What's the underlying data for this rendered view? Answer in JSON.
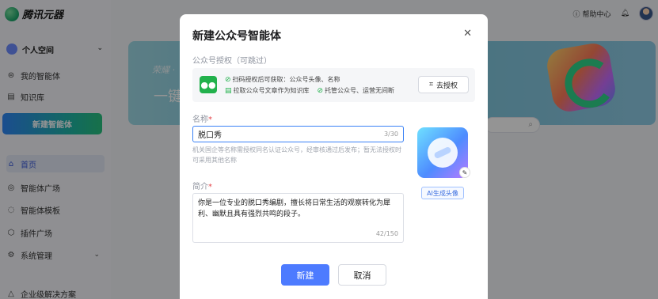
{
  "app": {
    "logo_text": "腾讯元器",
    "help_label": "帮助中心",
    "sidebar": {
      "space_label": "个人空间",
      "items_top": [
        {
          "label": "我的智能体",
          "icon": "agent-icon"
        },
        {
          "label": "知识库",
          "icon": "book-icon"
        }
      ],
      "new_agent_label": "新建智能体",
      "items_main": [
        {
          "label": "首页",
          "icon": "home-icon",
          "active": true
        },
        {
          "label": "智能体广场",
          "icon": "eye-icon"
        },
        {
          "label": "智能体模板",
          "icon": "template-icon"
        },
        {
          "label": "插件广场",
          "icon": "plugin-icon"
        },
        {
          "label": "系统管理",
          "icon": "gear-icon"
        }
      ],
      "enterprise_label": "企业级解决方案"
    },
    "banner": {
      "line1": "荣耀 ·",
      "line2": "一键"
    }
  },
  "modal": {
    "title": "新建公众号智能体",
    "auth_section_label": "公众号授权（可跳过）",
    "auth_features": [
      "扫码授权后可获取：公众号头像、名称",
      "拉取公众号文章作为知识库",
      "托管公众号、运营无间断"
    ],
    "auth_button_label": "去授权",
    "name_label": "名称",
    "name_value": "脱口秀",
    "name_count": "3/30",
    "name_hint": "机关国企等名称需授权同名认证公众号，经审核通过后发布；暂无法授权时可采用其他名称",
    "ai_avatar_label": "AI生成头像",
    "intro_label": "简介",
    "intro_value": "你是一位专业的脱口秀编剧，擅长将日常生活的观察转化为犀利、幽默且具有强烈共鸣的段子。",
    "intro_count": "42/150",
    "create_label": "新建",
    "cancel_label": "取消"
  },
  "colors": {
    "primary": "#4d7bff",
    "wechat_green": "#22b14c",
    "required": "#e5484d"
  }
}
